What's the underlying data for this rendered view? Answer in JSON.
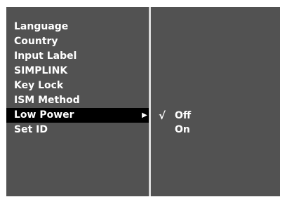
{
  "menu": {
    "items": [
      {
        "label": "Language"
      },
      {
        "label": "Country"
      },
      {
        "label": "Input Label"
      },
      {
        "label": "SIMPLINK"
      },
      {
        "label": "Key Lock"
      },
      {
        "label": "ISM Method"
      },
      {
        "label": "Low Power",
        "selected": true,
        "arrow": "▶"
      },
      {
        "label": "Set ID"
      }
    ]
  },
  "submenu": {
    "check_mark": "√",
    "options": [
      {
        "label": "Off",
        "checked": true
      },
      {
        "label": "On",
        "checked": false
      }
    ]
  },
  "icons": {
    "arrow": "right-arrow-icon",
    "check": "check-icon"
  },
  "colors": {
    "panel_bg": "#525252",
    "highlight_bg": "#000000",
    "divider": "#dcdcdc",
    "text": "#ffffff"
  }
}
